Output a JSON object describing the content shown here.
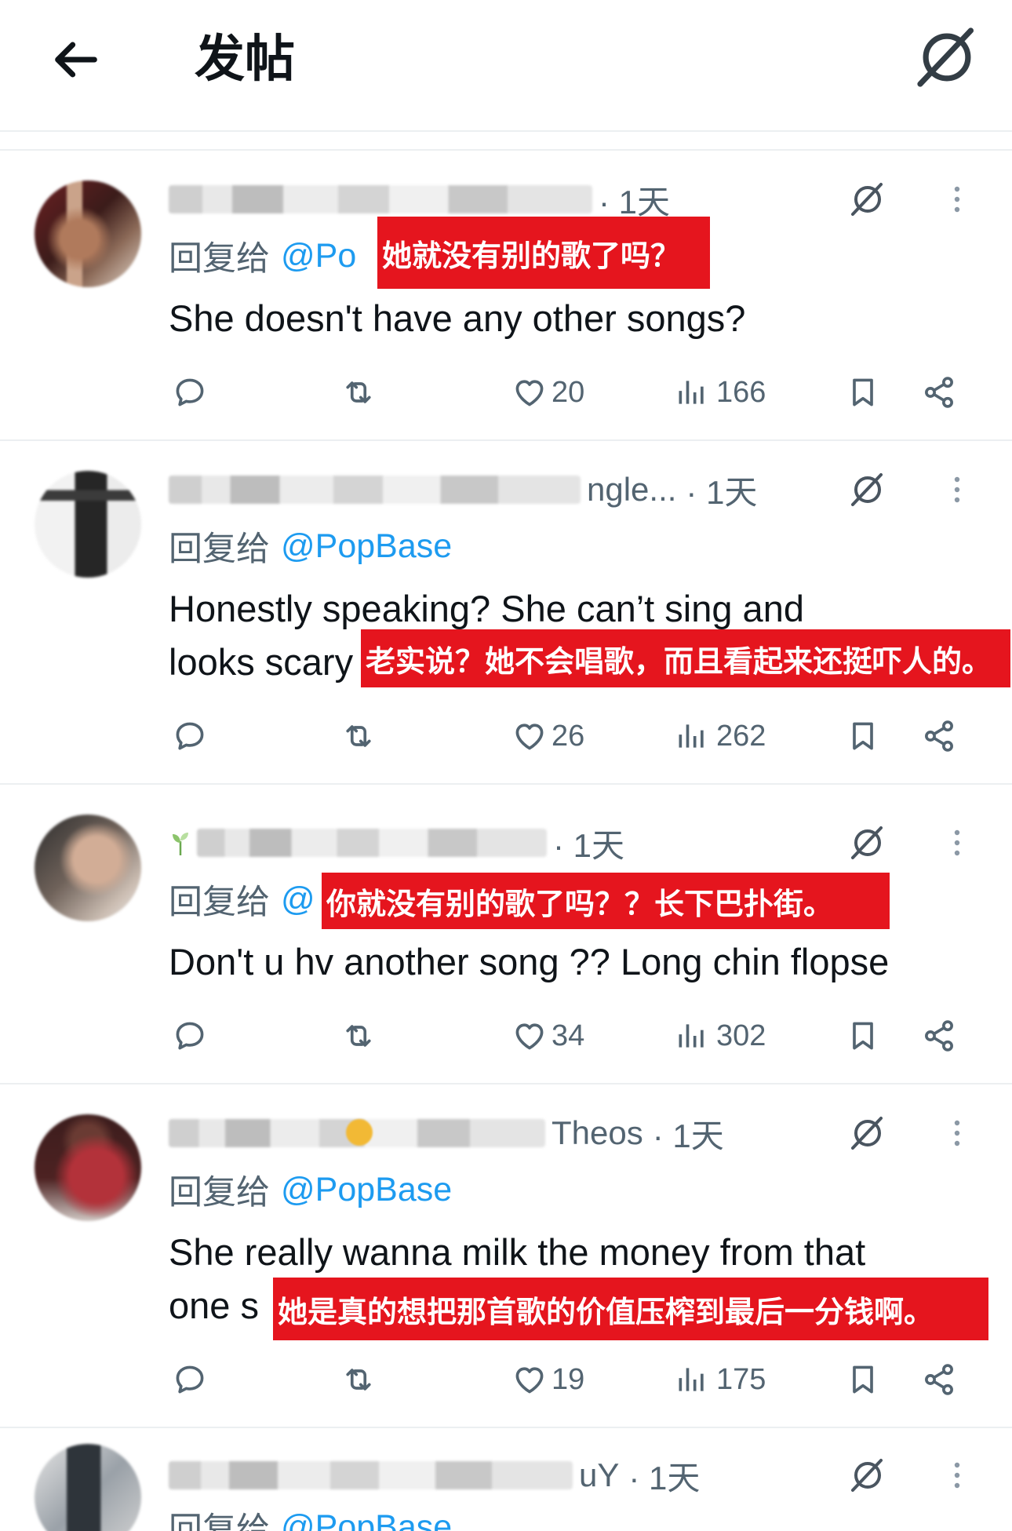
{
  "header": {
    "title": "发帖"
  },
  "icons": {
    "back": "arrow-left-icon",
    "grok": "grok-icon",
    "more": "more-icon",
    "reply": "reply-icon",
    "retweet": "retweet-icon",
    "like": "heart-icon",
    "views": "views-icon",
    "bookmark": "bookmark-icon",
    "share": "share-icon"
  },
  "colors": {
    "caption_bg": "#e5151e",
    "caption_text": "#ffffff",
    "handle": "#1d9bf0",
    "muted": "#536471",
    "text": "#0f1419"
  },
  "posts": [
    {
      "time": "· 1天",
      "reply_prefix": "回复给",
      "reply_handle": "@Po",
      "body": [
        "She doesn't have any other songs?"
      ],
      "likes": "20",
      "views": "166",
      "caption": "她就没有别的歌了吗？"
    },
    {
      "name_fragment": "ngle...",
      "time": "· 1天",
      "reply_prefix": "回复给",
      "reply_handle": "@PopBase",
      "body": [
        "Honestly speaking? She can’t sing and",
        "looks scary"
      ],
      "likes": "26",
      "views": "262",
      "caption": "老实说？她不会唱歌，而且看起来还挺吓人的。"
    },
    {
      "time": "· 1天",
      "reply_prefix": "回复给",
      "reply_handle": "@",
      "body": [
        "Don't u hv another song ?? Long chin flopse"
      ],
      "likes": "34",
      "views": "302",
      "caption": "你就没有别的歌了吗？？长下巴扑街。"
    },
    {
      "name_fragment": "Theos",
      "time": "· 1天",
      "reply_prefix": "回复给",
      "reply_handle": "@PopBase",
      "body": [
        "She really wanna milk the money from that",
        "one s"
      ],
      "likes": "19",
      "views": "175",
      "caption": "她是真的想把那首歌的价值压榨到最后一分钱啊。"
    },
    {
      "name_fragment": "uY",
      "time": "· 1天",
      "reply_prefix": "回复给",
      "reply_handle": "@PopBase"
    }
  ]
}
